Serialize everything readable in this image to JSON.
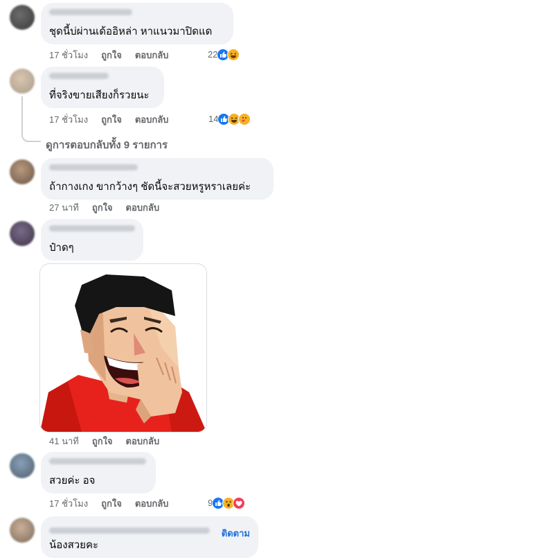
{
  "comments": [
    {
      "text": "ชุดนี้บ่ผ่านเด้ออิหล่า หาแนวมาปิดแด",
      "time": "17 ชั่วโมง",
      "like": "ถูกใจ",
      "reply": "ตอบกลับ",
      "reaction_count": "22",
      "reactions": [
        "like-icon",
        "haha-icon"
      ]
    },
    {
      "text": "ที่จริงขายเสียงก็รวยนะ",
      "time": "17 ชั่วโมง",
      "like": "ถูกใจ",
      "reply": "ตอบกลับ",
      "reaction_count": "14",
      "reactions": [
        "like-icon",
        "haha-icon",
        "care-icon"
      ]
    },
    {
      "text": "ถ้ากางเกง ขากว้างๆ ชัดนี้จะสวยหรูหราเลยค่ะ",
      "time": "27 นาที",
      "like": "ถูกใจ",
      "reply": "ตอบกลับ"
    },
    {
      "text": "ป๋าดๆ",
      "time": "41 นาที",
      "like": "ถูกใจ",
      "reply": "ตอบกลับ",
      "sticker": "laughing-man-sticker"
    },
    {
      "text": "สวยค่ะ อจ",
      "time": "17 ชั่วโมง",
      "like": "ถูกใจ",
      "reply": "ตอบกลับ",
      "reaction_count": "9",
      "reactions": [
        "like-icon",
        "wow-icon",
        "love-icon"
      ]
    },
    {
      "text": "น้องสวยคะ",
      "follow": "ติดตาม"
    }
  ],
  "view_replies": "ดูการตอบกลับทั้ง 9 รายการ",
  "colors": {
    "bubble": "#f0f2f5",
    "meta": "#65676b",
    "like_blue": "#1877f2",
    "link_blue": "#216fdb"
  }
}
